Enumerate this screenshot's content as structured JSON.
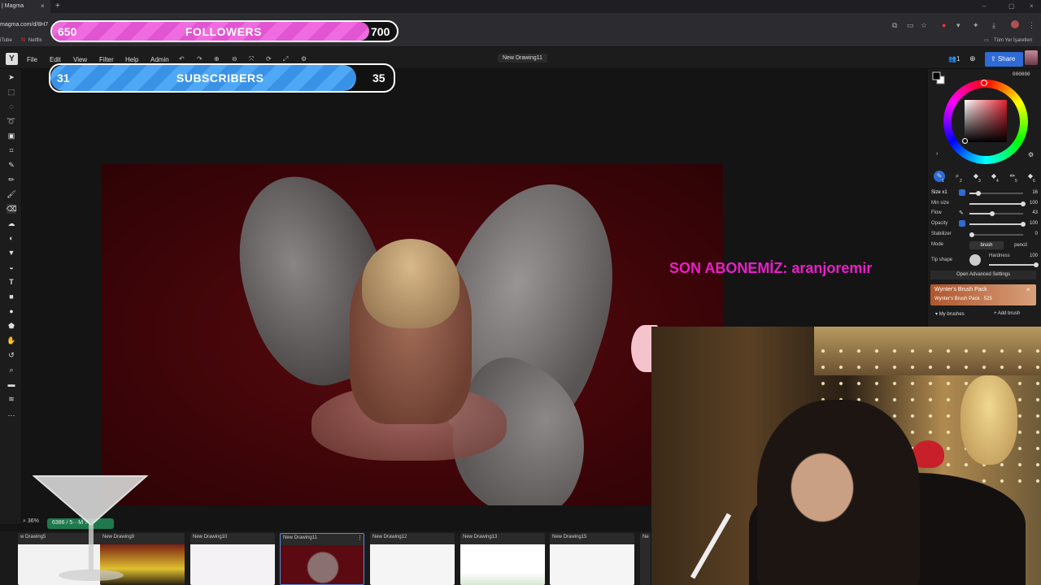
{
  "browser": {
    "tab_title": "| Magma",
    "tab_close": "×",
    "new_tab": "+",
    "url": "magma.com/d/8H7",
    "bookmarks": [
      "iTube",
      "Netflix"
    ],
    "bookmarks_all": "Tüm Yer İşaretleri",
    "window_controls": [
      "–",
      "▢",
      "×"
    ]
  },
  "app": {
    "logo": "Y",
    "menu": [
      "File",
      "Edit",
      "View",
      "Filter",
      "Help",
      "Admin"
    ],
    "document_title": "New Drawing11",
    "users_count": "1",
    "share_label": "Share"
  },
  "canvas": {
    "zoom": "36%",
    "pixels_info": "6386 / 5···M 7"
  },
  "thumbnails": [
    {
      "label": "w Drawing5",
      "active": false
    },
    {
      "label": "New Drawing9",
      "active": false
    },
    {
      "label": "New Drawing10",
      "active": false
    },
    {
      "label": "New Drawing11",
      "active": true
    },
    {
      "label": "New Drawing12",
      "active": false
    },
    {
      "label": "New Drawing13",
      "active": false
    },
    {
      "label": "New Drawing15",
      "active": false
    },
    {
      "label": "Ne",
      "active": false
    }
  ],
  "color_panel": {
    "hex": "000000",
    "current_color": "#000000"
  },
  "brush_slots": [
    "1",
    "2",
    "3",
    "4",
    "5",
    "6"
  ],
  "brush_settings": {
    "size_label": "Size x1",
    "size_value": "16",
    "size_level": 0.16,
    "minsize_label": "Min size",
    "minsize_value": "100",
    "minsize_level": 1.0,
    "flow_label": "Flow",
    "flow_value": "43",
    "flow_level": 0.43,
    "opacity_label": "Opacity",
    "opacity_value": "100",
    "opacity_level": 1.0,
    "stabilizer_label": "Stabilizer",
    "stabilizer_value": "0",
    "stabilizer_level": 0.0,
    "mode_label": "Mode",
    "mode_brush": "brush",
    "mode_pencil": "pencil",
    "tipshape_label": "Tip shape",
    "hardness_label": "Hardness",
    "hardness_value": "100",
    "hardness_level": 1.0,
    "advanced_button": "Open Advanced Settings"
  },
  "brush_pack": {
    "title": "Wynter's Brush Pack",
    "subtitle": "Wynter's Brush Pack · 525",
    "my_brushes": "My brushes",
    "add_brush": "Add brush"
  },
  "overlay": {
    "followers": {
      "start": "650",
      "title": "FOLLOWERS",
      "end": "700",
      "progress": 0.92
    },
    "subscribers": {
      "start": "31",
      "title": "SUBSCRIBERS",
      "end": "35",
      "progress": 0.89
    },
    "last_subscriber": "SON ABONEMİZ: aranjoremir"
  },
  "colors": {
    "share_blue": "#2e6bd6",
    "followers_pink": "#f06be0",
    "subscribers_blue": "#4fa8f5",
    "last_sub_magenta": "#e81fc7",
    "canvas_red": "#4a070c"
  }
}
